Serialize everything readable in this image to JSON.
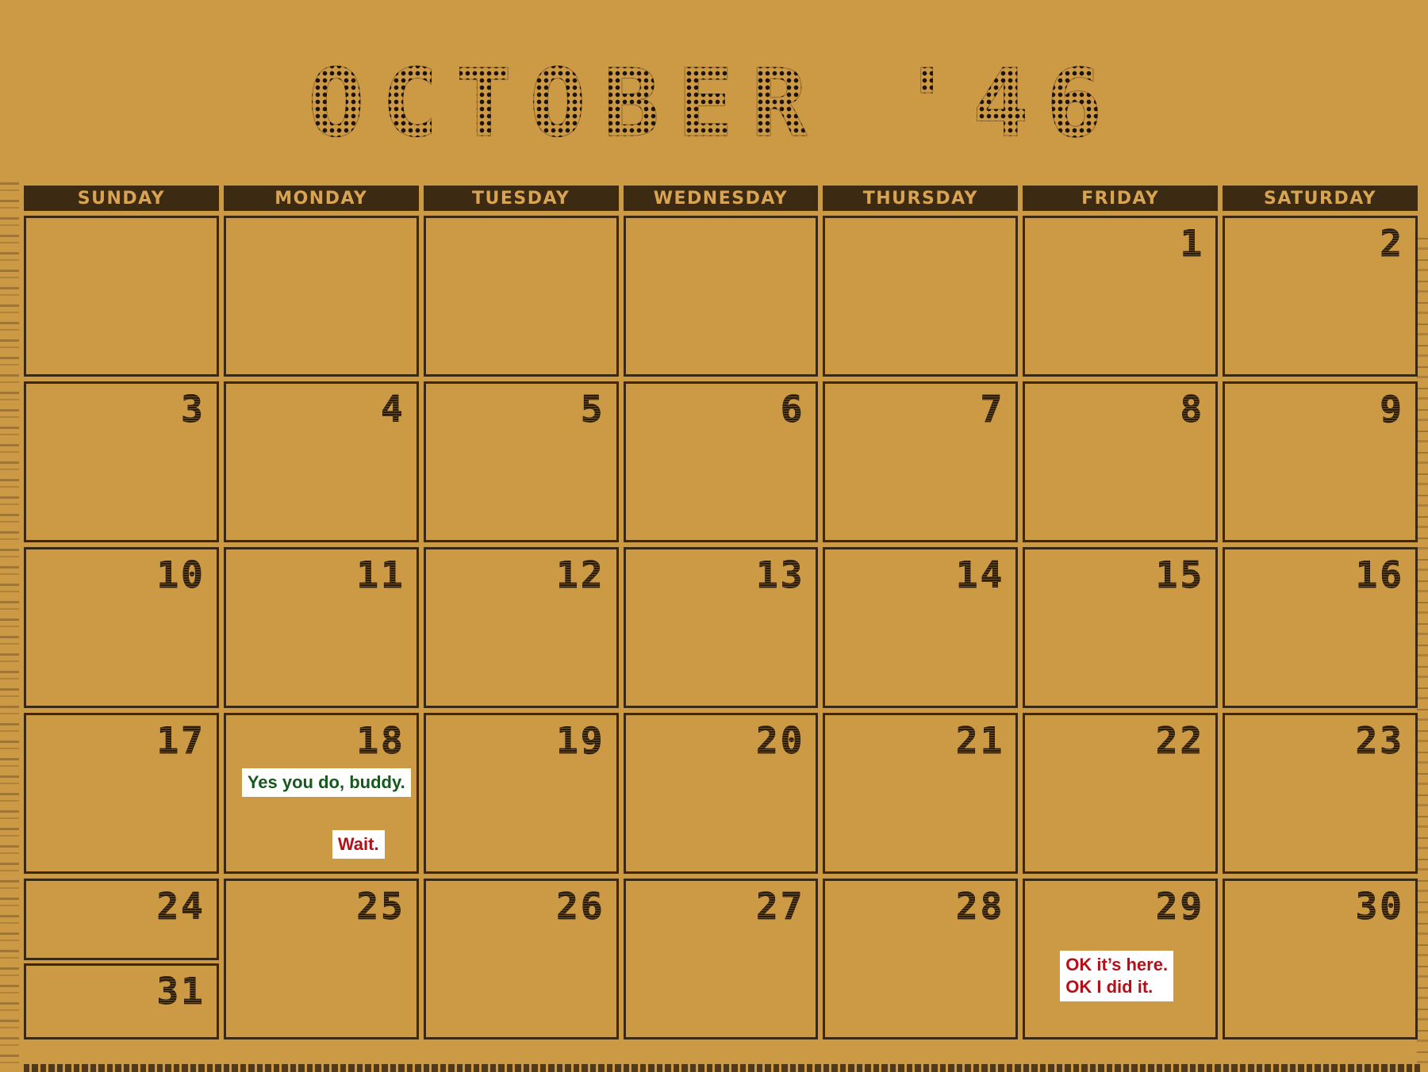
{
  "title": "OCTOBER '46",
  "weekdays": [
    "SUNDAY",
    "MONDAY",
    "TUESDAY",
    "WEDNESDAY",
    "THURSDAY",
    "FRIDAY",
    "SATURDAY"
  ],
  "days": {
    "d1": "1",
    "d2": "2",
    "d3": "3",
    "d4": "4",
    "d5": "5",
    "d6": "6",
    "d7": "7",
    "d8": "8",
    "d9": "9",
    "d10": "10",
    "d11": "11",
    "d12": "12",
    "d13": "13",
    "d14": "14",
    "d15": "15",
    "d16": "16",
    "d17": "17",
    "d18": "18",
    "d19": "19",
    "d20": "20",
    "d21": "21",
    "d22": "22",
    "d23": "23",
    "d24": "24",
    "d25": "25",
    "d26": "26",
    "d27": "27",
    "d28": "28",
    "d29": "29",
    "d30": "30",
    "d31": "31"
  },
  "notes": {
    "monday18_note1": "Yes you do, buddy.",
    "monday18_note2": "Wait.",
    "friday29_line1": "OK it’s here.",
    "friday29_line2": "OK I did it."
  },
  "colors": {
    "background": "#cc9945",
    "ink": "#3b2810",
    "note_green": "#17581c",
    "note_red": "#b3101a"
  }
}
